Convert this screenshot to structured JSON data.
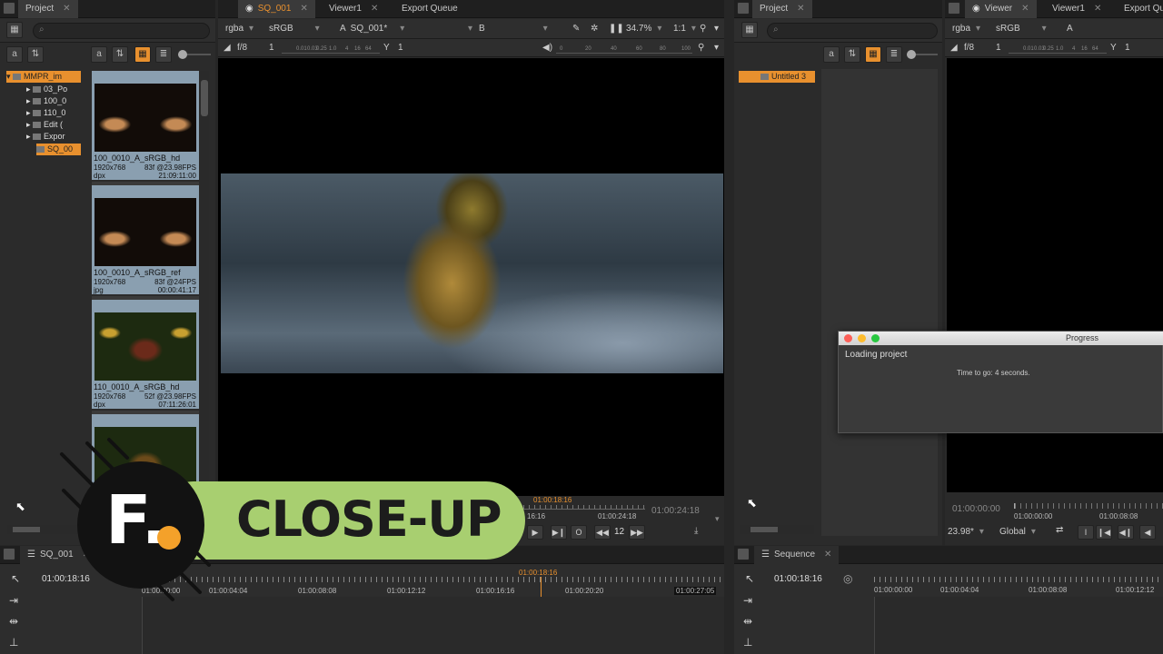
{
  "left_project": {
    "tab": "Project",
    "root": "MMPR_im",
    "folders": [
      "03_Po",
      "100_0",
      "110_0",
      "Edit (",
      "Expor",
      "SQ_00"
    ],
    "clips": [
      {
        "name": "100_0010_A_sRGB_hd",
        "res": "1920x768",
        "frames": "83f @23.98FPS",
        "type": "dpx",
        "tc": "21:09:11:00"
      },
      {
        "name": "100_0010_A_sRGB_ref",
        "res": "1920x768",
        "frames": "83f @24FPS",
        "type": "jpg",
        "tc": "00:00:41:17"
      },
      {
        "name": "110_0010_A_sRGB_hd",
        "res": "1920x768",
        "frames": "52f @23.98FPS",
        "type": "dpx",
        "tc": "07:11:26:01"
      }
    ]
  },
  "viewer": {
    "tabs": [
      "SQ_001",
      "Viewer1",
      "Export Queue"
    ],
    "channels": "rgba",
    "colorspace": "sRGB",
    "a_label": "A",
    "input_a": "SQ_001*",
    "b_label": "B",
    "zoom": "34.7%",
    "ratio": "1:1",
    "fstop": "f/8",
    "frame": "1",
    "y_label": "Y",
    "y_value": "1",
    "ruler_left": [
      "0.01",
      "0.03",
      "0.25",
      "1.0",
      "4",
      "16",
      "64"
    ],
    "ruler_right": [
      "0",
      "20",
      "40",
      "60",
      "80",
      "100"
    ],
    "timeline_playhead": "01:00:18:16",
    "timeline_mid": "01:00:24:18",
    "timeline_left": "16:16",
    "end_time": "01:00:24:18",
    "frame_step": "12"
  },
  "bottom_left": {
    "tab": "SQ_001",
    "current_tc": "01:00:18:16",
    "playhead": "01:00:18:16",
    "ticks": [
      "01:00:00:00",
      "01:00:04:04",
      "01:00:08:08",
      "01:00:12:12",
      "01:00:16:16",
      "01:00:20:20",
      "01:00:27:05"
    ]
  },
  "right_project": {
    "tab": "Project",
    "root": "Untitled 3"
  },
  "right_viewer": {
    "tabs": [
      "Viewer",
      "Viewer1",
      "Export Queu"
    ],
    "channels": "rgba",
    "colorspace": "sRGB",
    "a_label": "A",
    "fstop": "f/8",
    "frame": "1",
    "y_label": "Y",
    "y_value": "1",
    "ruler_left": [
      "0.01",
      "0.03",
      "0.25",
      "1.0",
      "4",
      "16",
      "64"
    ],
    "timecode": "01:00:00:00",
    "tl_start": "01:00:00:00",
    "tl_end": "01:00:08:08",
    "fps": "23.98*",
    "scope": "Global"
  },
  "progress_dialog": {
    "title": "Progress",
    "message": "Loading project",
    "detail": "Time to go: 4 seconds."
  },
  "bottom_right": {
    "tab": "Sequence",
    "current_tc": "01:00:18:16",
    "ticks": [
      "01:00:00:00",
      "01:00:04:04",
      "01:00:08:08",
      "01:00:12:12"
    ]
  },
  "overlay": {
    "logo_letter": "F.",
    "label": "CLOSE-UP"
  },
  "colors": {
    "accent": "#e8902e",
    "badge_green": "#a8cf70"
  }
}
